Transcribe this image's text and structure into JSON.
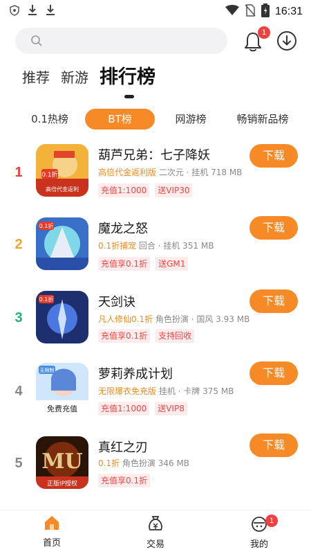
{
  "status_bar": {
    "time": "16:31"
  },
  "header": {
    "notification_count": "1"
  },
  "main_tabs": [
    {
      "label": "推荐"
    },
    {
      "label": "新游"
    },
    {
      "label": "排行榜"
    }
  ],
  "sub_tabs": [
    {
      "label": "0.1热榜"
    },
    {
      "label": "BT榜"
    },
    {
      "label": "网游榜"
    },
    {
      "label": "畅销新品榜"
    }
  ],
  "games": [
    {
      "rank": "1",
      "name": "葫芦兄弟：七子降妖",
      "promo": "高倍代金返利版",
      "meta": "二次元 · 挂机  718 MB",
      "tags": [
        "充值1:1000",
        "送VIP30"
      ],
      "download_label": "下载",
      "rank_color": "#e8403a"
    },
    {
      "rank": "2",
      "name": "魔龙之怒",
      "promo": "0.1折捕宠",
      "meta": "回合 · 挂机  351 MB",
      "tags": [
        "充值享0.1折",
        "送GM1"
      ],
      "download_label": "下载",
      "rank_color": "#f2a22a"
    },
    {
      "rank": "3",
      "name": "天剑诀",
      "promo": "凡人修仙0.1折",
      "meta": "角色扮演 · 国风  3.93 MB",
      "tags": [
        "充值享0.1折",
        "支持回收"
      ],
      "download_label": "下载",
      "rank_color": "#22b07a"
    },
    {
      "rank": "4",
      "name": "萝莉养成计划",
      "promo": "无限爆衣免充版",
      "meta": "挂机 · 卡牌  375 MB",
      "tags": [
        "充值1:1000",
        "送VIP8"
      ],
      "download_label": "下载",
      "rank_color": "#888888"
    },
    {
      "rank": "5",
      "name": "真红之刃",
      "promo": "0.1折",
      "meta": "角色扮演  346 MB",
      "tags": [
        "充值享0.1折"
      ],
      "download_label": "下载",
      "rank_color": "#888888"
    }
  ],
  "bottom_nav": [
    {
      "label": "首页"
    },
    {
      "label": "交易"
    },
    {
      "label": "我的",
      "badge": "1"
    }
  ],
  "colors": {
    "accent": "#f68a27",
    "tag_text": "#ef4545",
    "tag_bg": "#fdecec",
    "promo": "#f08a1c"
  }
}
